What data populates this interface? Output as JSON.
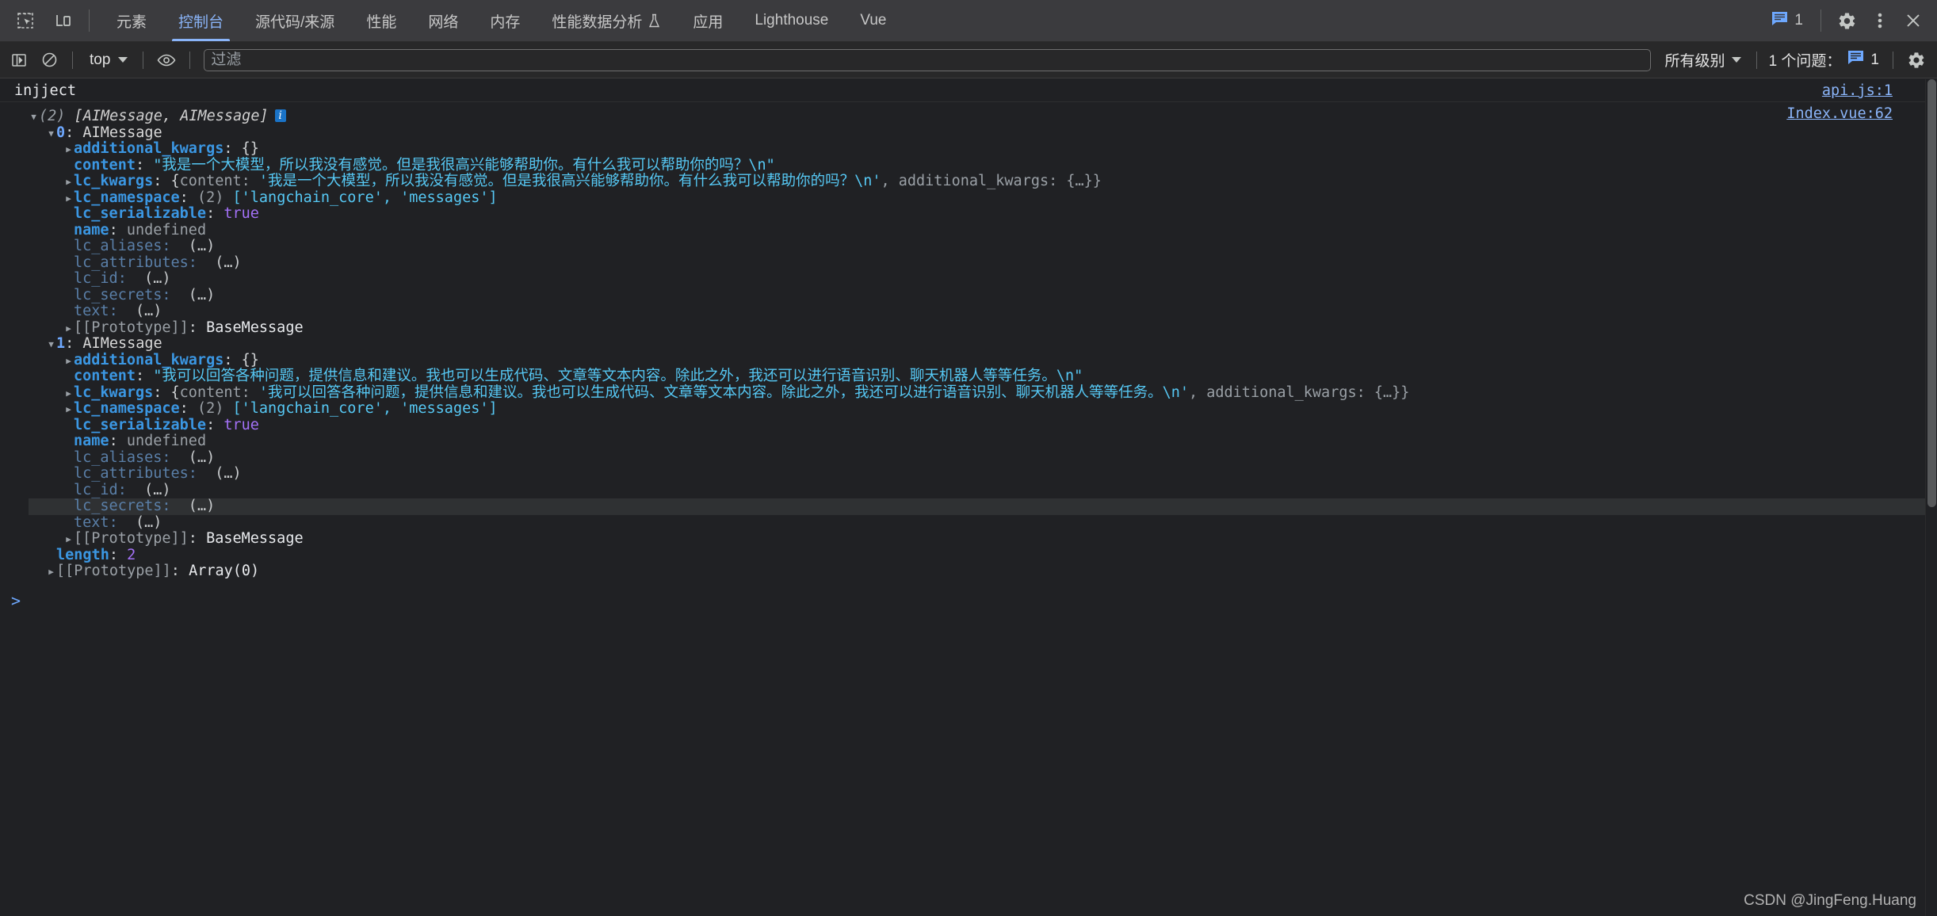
{
  "toolbar": {
    "inspect_icon": "inspect-element-icon",
    "device_icon": "device-toolbar-icon",
    "tabs": [
      {
        "label": "元素",
        "selected": false
      },
      {
        "label": "控制台",
        "selected": true
      },
      {
        "label": "源代码/来源",
        "selected": false
      },
      {
        "label": "性能",
        "selected": false
      },
      {
        "label": "网络",
        "selected": false
      },
      {
        "label": "内存",
        "selected": false
      },
      {
        "label": "性能数据分析",
        "selected": false,
        "badge_icon": "beaker-icon"
      },
      {
        "label": "应用",
        "selected": false
      },
      {
        "label": "Lighthouse",
        "selected": false
      },
      {
        "label": "Vue",
        "selected": false
      }
    ],
    "issues_count": "1",
    "issues_icon": "issues-message-icon",
    "settings_icon": "gear-icon",
    "more_icon": "kebab-menu-icon",
    "close_icon": "close-icon",
    "accent_color": "#8ab4f8"
  },
  "console_toolbar": {
    "sidebar_icon": "console-sidebar-icon",
    "clear_icon": "clear-console-icon",
    "context": "top",
    "eye_icon": "live-expression-icon",
    "filter_placeholder": "过滤",
    "filter_value": "",
    "level": "所有级别",
    "issues_label": "1 个问题：",
    "issues_badge_icon": "issues-message-icon",
    "issues_badge_count": "1",
    "settings_icon": "gear-icon"
  },
  "console": {
    "messages": [
      {
        "text": "injject",
        "source": "api.js:1"
      }
    ],
    "object_source": "Index.vue:62",
    "array_header": {
      "count": "(2)",
      "preview": "[AIMessage, AIMessage]",
      "info_badge": "i"
    },
    "items": [
      {
        "index": "0",
        "ctor": "AIMessage",
        "props": [
          {
            "kind": "expandable",
            "key": "additional_kwargs",
            "value": "{}"
          },
          {
            "kind": "string",
            "key": "content",
            "value": "\"我是一个大模型，所以我没有感觉。但是我很高兴能够帮助你。有什么我可以帮助你的吗？\\n\""
          },
          {
            "kind": "kwargs",
            "key": "lc_kwargs",
            "open": "{",
            "inner_key": "content",
            "inner_value": "'我是一个大模型，所以我没有感觉。但是我很高兴能够帮助你。有什么我可以帮助你的吗？\\n'",
            "tail": ", additional_kwargs: {…}}"
          },
          {
            "kind": "array",
            "key": "lc_namespace",
            "count": "(2)",
            "value": "['langchain_core', 'messages']"
          },
          {
            "kind": "bool",
            "key": "lc_serializable",
            "value": "true"
          },
          {
            "kind": "undef",
            "key": "name",
            "value": "undefined"
          },
          {
            "kind": "getter",
            "key": "lc_aliases",
            "value": "(…)"
          },
          {
            "kind": "getter",
            "key": "lc_attributes",
            "value": "(…)"
          },
          {
            "kind": "getter",
            "key": "lc_id",
            "value": "(…)"
          },
          {
            "kind": "getter",
            "key": "lc_secrets",
            "value": "(…)"
          },
          {
            "kind": "getter",
            "key": "text",
            "value": "(…)"
          },
          {
            "kind": "proto",
            "key": "[[Prototype]]",
            "value": "BaseMessage"
          }
        ]
      },
      {
        "index": "1",
        "ctor": "AIMessage",
        "props": [
          {
            "kind": "expandable",
            "key": "additional_kwargs",
            "value": "{}"
          },
          {
            "kind": "string",
            "key": "content",
            "value": "\"我可以回答各种问题，提供信息和建议。我也可以生成代码、文章等文本内容。除此之外，我还可以进行语音识别、聊天机器人等等任务。\\n\""
          },
          {
            "kind": "kwargs",
            "key": "lc_kwargs",
            "open": "{",
            "inner_key": "content",
            "inner_value": "'我可以回答各种问题，提供信息和建议。我也可以生成代码、文章等文本内容。除此之外，我还可以进行语音识别、聊天机器人等等任务。\\n'",
            "tail": ", additional_kwargs: {…}}"
          },
          {
            "kind": "array",
            "key": "lc_namespace",
            "count": "(2)",
            "value": "['langchain_core', 'messages']"
          },
          {
            "kind": "bool",
            "key": "lc_serializable",
            "value": "true"
          },
          {
            "kind": "undef",
            "key": "name",
            "value": "undefined"
          },
          {
            "kind": "getter",
            "key": "lc_aliases",
            "value": "(…)"
          },
          {
            "kind": "getter",
            "key": "lc_attributes",
            "value": "(…)"
          },
          {
            "kind": "getter",
            "key": "lc_id",
            "value": "(…)"
          },
          {
            "kind": "getter",
            "key": "lc_secrets",
            "value": "(…)",
            "highlighted": true
          },
          {
            "kind": "getter",
            "key": "text",
            "value": "(…)"
          },
          {
            "kind": "proto",
            "key": "[[Prototype]]",
            "value": "BaseMessage"
          }
        ]
      }
    ],
    "length_key": "length",
    "length_value": "2",
    "array_proto_key": "[[Prototype]]",
    "array_proto_value": "Array(0)",
    "prompt_symbol": ">"
  },
  "watermark": "CSDN @JingFeng.Huang"
}
